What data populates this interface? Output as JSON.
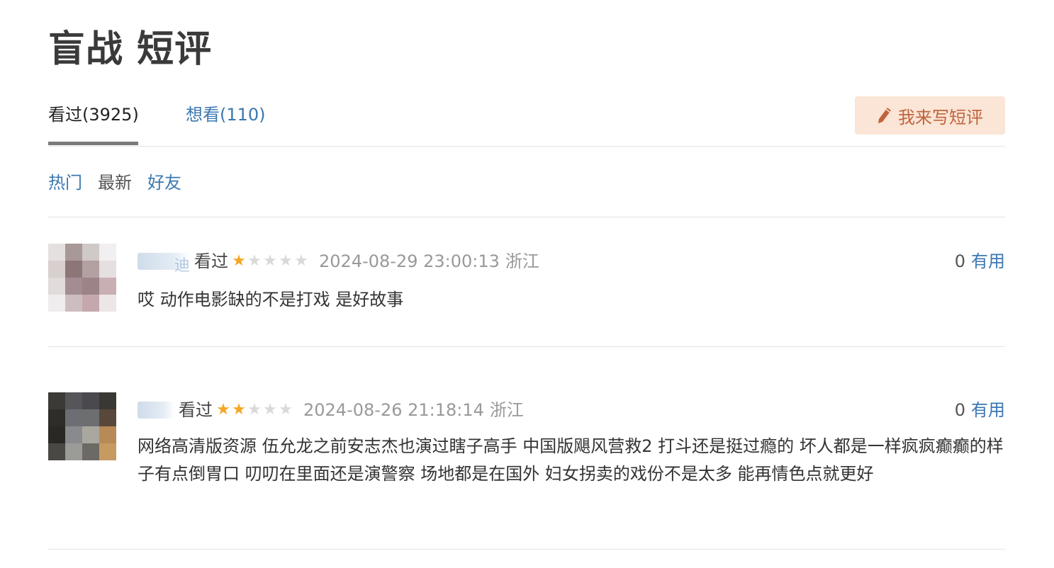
{
  "page_title": "盲战 短评",
  "status_tabs": {
    "watched": "看过(3925)",
    "wish": "想看(110)"
  },
  "write_button": {
    "label": "我来写短评",
    "icon": "pencil-icon"
  },
  "sort_tabs": {
    "hot": "热门",
    "newest": "最新",
    "friends": "好友"
  },
  "comments": [
    {
      "username_fragment": "迪",
      "watched_label": "看过",
      "rating": 1,
      "max_rating": 5,
      "time": "2024-08-29 23:00:13",
      "location": "浙江",
      "vote_count": "0",
      "useful_label": "有用",
      "content": "哎 动作电影缺的不是打戏 是好故事"
    },
    {
      "username_fragment": "",
      "watched_label": "看过",
      "rating": 2,
      "max_rating": 5,
      "time": "2024-08-26 21:18:14",
      "location": "浙江",
      "vote_count": "0",
      "useful_label": "有用",
      "content": "网络高清版资源 伍允龙之前安志杰也演过瞎子高手 中国版飓风营救2 打斗还是挺过瘾的 坏人都是一样疯疯癫癫的样子有点倒胃口 叨叨在里面还是演警察 场地都是在国外 妇女拐卖的戏份不是太多 能再情色点就更好"
    }
  ],
  "colors": {
    "link": "#3a77b0",
    "star_on": "#f5a623",
    "star_off": "#d9d9d9",
    "write_button_bg": "#fae5d6",
    "write_button_text": "#c0633c"
  }
}
